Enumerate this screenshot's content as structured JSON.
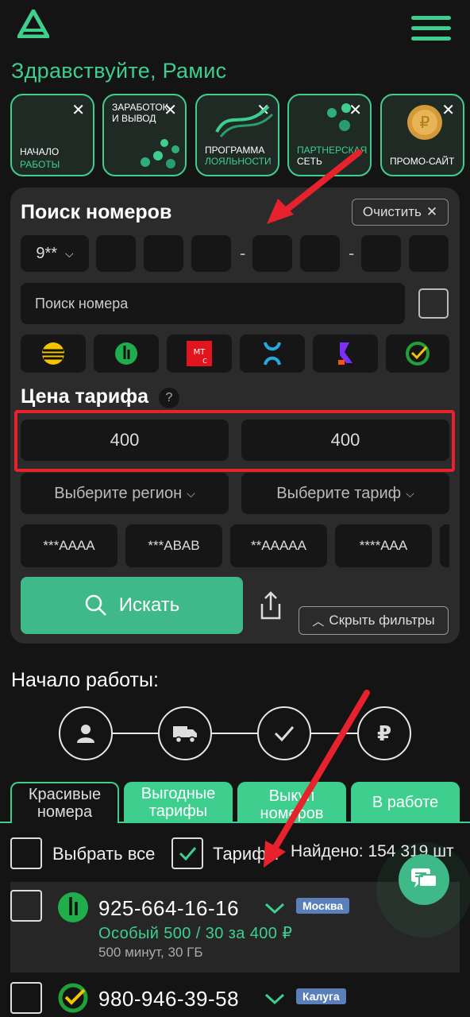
{
  "header": {
    "greeting": "Здравствуйте, Рамис"
  },
  "stories": [
    {
      "line1": "НАЧАЛО",
      "line2": "РАБОТЫ"
    },
    {
      "line1": "ЗАРАБОТОК",
      "line1b": "И ВЫВОД",
      "line2": ""
    },
    {
      "line1": "ПРОГРАММА",
      "line2": "ЛОЯЛЬНОСТИ"
    },
    {
      "line1": "ПАРТНЕРСКАЯ",
      "line1b": "СЕТЬ",
      "line2": ""
    },
    {
      "line1": "ПРОМО-САЙТ",
      "line2": ""
    }
  ],
  "filters": {
    "title": "Поиск номеров",
    "clear_label": "Очистить",
    "prefix": "9**",
    "search_placeholder": "Поиск номера",
    "price_title": "Цена тарифа",
    "price_from": "400",
    "price_to": "400",
    "region_placeholder": "Выберите регион",
    "tariff_placeholder": "Выберите тариф",
    "patterns": [
      "***AAAA",
      "***ABAB",
      "**AAAAA",
      "****AAA"
    ],
    "search_button": "Искать",
    "hide_filters": "Скрыть фильтры"
  },
  "onboarding": {
    "title": "Начало работы:"
  },
  "tabs": [
    {
      "label_line1": "Красивые",
      "label_line2": "номера"
    },
    {
      "label_line1": "Выгодные",
      "label_line2": "тарифы"
    },
    {
      "label_line1": "Выкуп",
      "label_line2": "номеров"
    },
    {
      "label_line1": "В работе",
      "label_line2": ""
    }
  ],
  "list_controls": {
    "select_all": "Выбрать все",
    "tariffs": "Тарифы",
    "found": "Найдено: 154 319 шт"
  },
  "items": [
    {
      "phone": "925-664-16-16",
      "region": "Москва",
      "tariff": "Особый 500 / 30 за 400 ₽",
      "details": "500 минут, 30 ГБ"
    },
    {
      "phone": "980-946-39-58",
      "region": "Калуга"
    }
  ],
  "colors": {
    "accent": "#3ecf8e",
    "background": "#141414",
    "card": "#2b2b2b",
    "highlight": "#e8222c"
  }
}
